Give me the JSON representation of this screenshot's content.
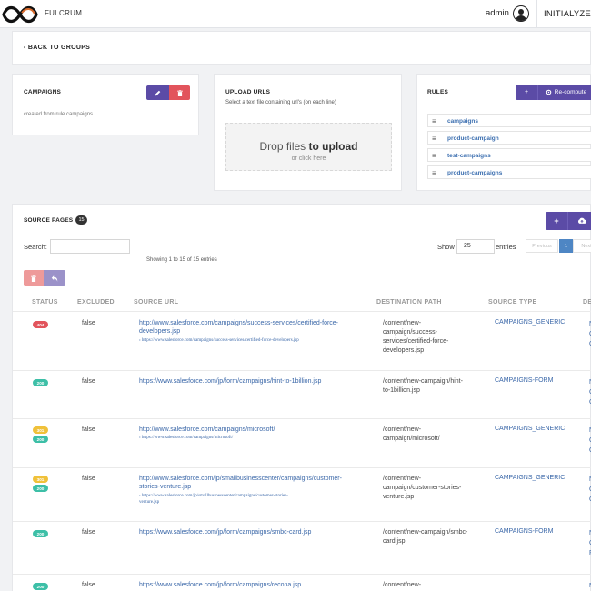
{
  "header": {
    "brand": "FULCRUM",
    "user": "admin",
    "org": "INITIALYZE"
  },
  "back": {
    "label": "BACK TO GROUPS"
  },
  "campaigns": {
    "title": "CAMPAIGNS",
    "description": "created from rule campaigns",
    "edit_icon": "edit-icon",
    "delete_icon": "trash-icon"
  },
  "upload": {
    "title": "UPLOAD URLS",
    "subtitle": "Select a text file containing url's (on each line)",
    "drop_text": "Drop files",
    "drop_bold": "to upload",
    "drop_sub": "or click here"
  },
  "rules": {
    "title": "RULES",
    "recompute_label": "Re-compute",
    "items": [
      "campaigns",
      "product-campaign",
      "test-campaigns",
      "product-campaigns"
    ]
  },
  "source": {
    "title": "SOURCE PAGES",
    "count": "15",
    "search_label": "Search:",
    "showing": "Showing 1 to 15 of 15 entries",
    "show_label": "Show",
    "show_value": "25",
    "entries_label": "entries",
    "prev": "Previous",
    "page": "1",
    "next": "Next",
    "columns": [
      "STATUS",
      "EXCLUDED",
      "SOURCE URL",
      "DESTINATION PATH",
      "SOURCE TYPE",
      "DE"
    ],
    "rows": [
      {
        "status": [
          "404"
        ],
        "excluded": "false",
        "url_l1": "http://www.salesforce.com/campaigns/success-services/certified-force-",
        "url_l2": "developers.jsp",
        "redir_l1": "https://www.salesforce.com/campaigns/success-services/certified-force-developers.jsp",
        "redir_l2": "",
        "dest": [
          "/content/new-",
          "campaign/success-",
          "services/certified-force-",
          "developers.jsp"
        ],
        "stype": "CAMPAIGNS_GENERIC",
        "trunc": [
          "N",
          "C",
          "C"
        ]
      },
      {
        "status": [
          "200"
        ],
        "excluded": "false",
        "url_l1": "https://www.salesforce.com/jp/form/campaigns/hint-to-1billion.jsp",
        "url_l2": "",
        "redir_l1": "",
        "redir_l2": "",
        "dest": [
          "/content/new-campaign/hint-",
          "to-1billion.jsp"
        ],
        "stype": "CAMPAIGNS-FORM",
        "trunc": [
          "N",
          "C",
          "C"
        ]
      },
      {
        "status": [
          "301",
          "200"
        ],
        "excluded": "false",
        "url_l1": "http://www.salesforce.com/campaigns/microsoft/",
        "url_l2": "",
        "redir_l1": "https://www.salesforce.com/campaigns/microsoft/",
        "redir_l2": "",
        "dest": [
          "/content/new-",
          "campaign/microsoft/"
        ],
        "stype": "CAMPAIGNS_GENERIC",
        "trunc": [
          "N",
          "C",
          "C"
        ]
      },
      {
        "status": [
          "301",
          "200"
        ],
        "excluded": "false",
        "url_l1": "http://www.salesforce.com/jp/smallbusinesscenter/campaigns/customer-",
        "url_l2": "stories-venture.jsp",
        "redir_l1": "https://www.salesforce.com/jp/smallbusinesscenter/campaigns/customer-stories-",
        "redir_l2": "venture.jsp",
        "dest": [
          "/content/new-",
          "campaign/customer-stories-",
          "venture.jsp"
        ],
        "stype": "CAMPAIGNS_GENERIC",
        "trunc": [
          "N",
          "C",
          "C"
        ]
      },
      {
        "status": [
          "200"
        ],
        "excluded": "false",
        "url_l1": "https://www.salesforce.com/jp/form/campaigns/smbc-card.jsp",
        "url_l2": "",
        "redir_l1": "",
        "redir_l2": "",
        "dest": [
          "/content/new-campaign/smbc-",
          "card.jsp"
        ],
        "stype": "CAMPAIGNS-FORM",
        "trunc": [
          "N",
          "C",
          "F"
        ]
      },
      {
        "status": [
          "200"
        ],
        "excluded": "false",
        "url_l1": "https://www.salesforce.com/jp/form/campaigns/recona.jsp",
        "url_l2": "",
        "redir_l1": "",
        "redir_l2": "",
        "dest": [
          "/content/new-"
        ],
        "stype": "",
        "trunc": [
          "N"
        ]
      }
    ]
  },
  "colors": {
    "purple": "#5b4ba6",
    "red": "#e2545c",
    "green": "#3dbfa7",
    "yellow": "#f0c13a",
    "link": "#3a67a8"
  }
}
